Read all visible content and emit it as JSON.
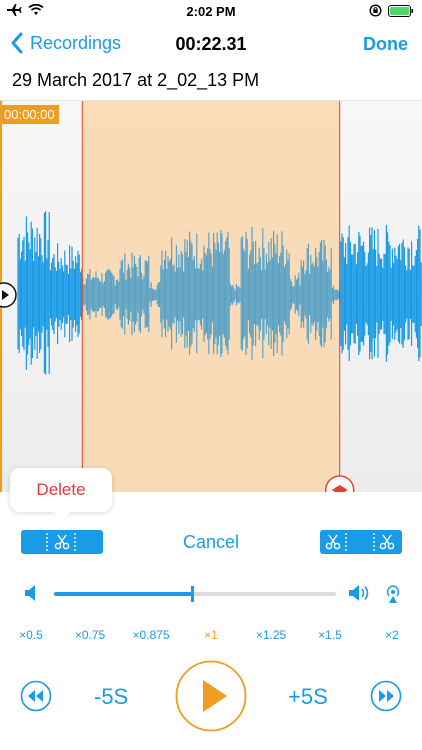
{
  "status": {
    "time": "2:02 PM"
  },
  "nav": {
    "back_label": "Recordings",
    "title": "00:22.31",
    "done_label": "Done"
  },
  "recording": {
    "name": "29 March 2017 at 2_02_13 PM"
  },
  "waveform": {
    "time_marker": "00:00:00",
    "selection_start_fraction": 0.195,
    "selection_end_fraction": 0.805
  },
  "edit": {
    "delete_label": "Delete",
    "cancel_label": "Cancel"
  },
  "volume": {
    "level": 0.49
  },
  "speeds": {
    "items": [
      "×0.5",
      "×0.75",
      "×0.875",
      "×1",
      "×1.25",
      "×1.5",
      "×2"
    ],
    "selected_index": 3
  },
  "playback": {
    "rewind_label": "-5S",
    "forward_label": "+5S"
  },
  "colors": {
    "accent": "#1a9be6",
    "orange": "#ef9d1e",
    "selection": "#f9d9b0",
    "delete_red": "#e23a3a"
  },
  "icons": [
    "airplane-icon",
    "wifi-icon",
    "orientation-lock-icon",
    "battery-icon",
    "chevron-left-icon",
    "scissors-icon",
    "speaker-low-icon",
    "speaker-high-icon",
    "airplay-icon",
    "rewind-icon",
    "play-icon",
    "fast-forward-icon"
  ]
}
